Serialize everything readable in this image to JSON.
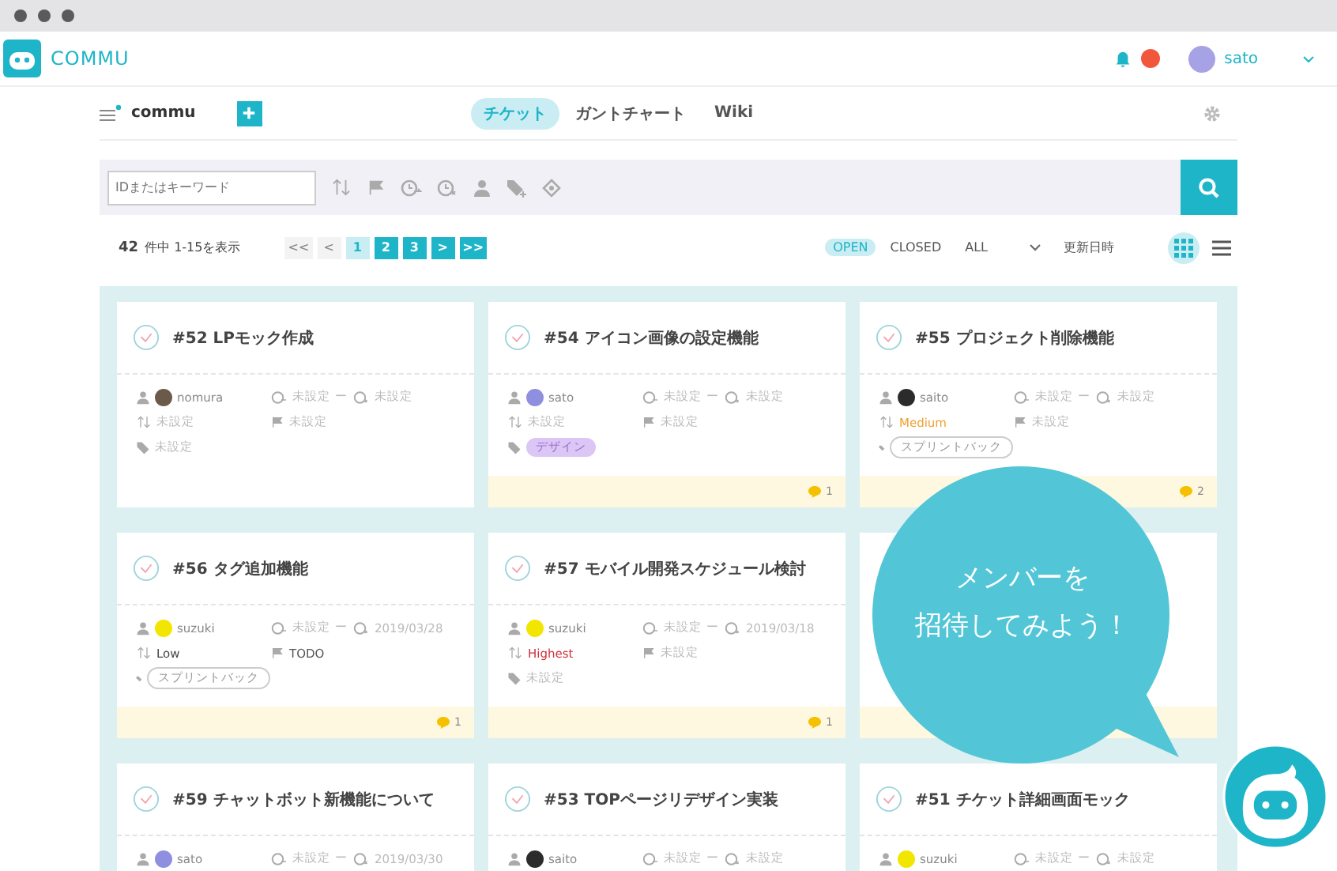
{
  "app": {
    "brand": "COMMU",
    "notification": true,
    "user": "sato"
  },
  "project": {
    "name": "commu"
  },
  "tabs": [
    {
      "label": "チケット",
      "selected": true
    },
    {
      "label": "ガントチャート",
      "selected": false
    },
    {
      "label": "Wiki",
      "selected": false
    }
  ],
  "search": {
    "placeholder": "IDまたはキーワード"
  },
  "summary": {
    "count": "42",
    "text": "件中 1-15を表示"
  },
  "pager": [
    {
      "label": "<<",
      "selected": false,
      "disabled": true
    },
    {
      "label": "<",
      "selected": false,
      "disabled": true
    },
    {
      "label": "1",
      "selected": true,
      "disabled": false
    },
    {
      "label": "2",
      "selected": false,
      "disabled": false
    },
    {
      "label": "3",
      "selected": false,
      "disabled": false
    },
    {
      "label": ">",
      "selected": false,
      "disabled": false
    },
    {
      "label": ">>",
      "selected": false,
      "disabled": false
    }
  ],
  "status_filter": [
    {
      "label": "OPEN",
      "selected": true
    },
    {
      "label": "CLOSED",
      "selected": false
    }
  ],
  "scope": {
    "value": "ALL"
  },
  "sort": {
    "value": "更新日時"
  },
  "views": [
    {
      "kind": "grid",
      "selected": true
    },
    {
      "kind": "list",
      "selected": false
    }
  ],
  "tickets": [
    {
      "kind": "card",
      "title": "#52 LPモック作成",
      "assignee": {
        "name": "nomura",
        "color": "#6b5a4a"
      },
      "start": "未設定",
      "sep": "ー",
      "end": "未設定",
      "priority": {
        "label": "未設定",
        "kind": "none"
      },
      "status": {
        "label": "未設定",
        "kind": "none"
      },
      "tag": {
        "label": "未設定",
        "kind": "none"
      }
    },
    {
      "kind": "card",
      "title": "#54 アイコン画像の設定機能",
      "assignee": {
        "name": "sato",
        "color": "#8f8fe0"
      },
      "start": "未設定",
      "sep": "ー",
      "end": "未設定",
      "priority": {
        "label": "未設定",
        "kind": "none"
      },
      "status": {
        "label": "未設定",
        "kind": "none"
      },
      "tag": {
        "label": "デザイン",
        "kind": "filled",
        "color": "#dcc6f5"
      },
      "comments": "1"
    },
    {
      "kind": "card",
      "title": "#55 プロジェクト削除機能",
      "assignee": {
        "name": "saito",
        "color": "#2b2b2b"
      },
      "start": "未設定",
      "sep": "ー",
      "end": "未設定",
      "priority": {
        "label": "Medium",
        "kind": "medium"
      },
      "status": {
        "label": "未設定",
        "kind": "none"
      },
      "tag": {
        "label": "スプリントバック",
        "kind": "outline"
      },
      "comments": "2"
    },
    {
      "kind": "card",
      "title": "#56 タグ追加機能",
      "assignee": {
        "name": "suzuki",
        "color": "#f2e600"
      },
      "start": "未設定",
      "sep": "ー",
      "end": "2019/03/28",
      "priority": {
        "label": "Low",
        "kind": "low"
      },
      "status": {
        "label": "TODO",
        "kind": "set"
      },
      "tag": {
        "label": "スプリントバック",
        "kind": "outline"
      },
      "comments": "1"
    },
    {
      "kind": "card",
      "title": "#57 モバイル開発スケジュール検討",
      "assignee": {
        "name": "suzuki",
        "color": "#f2e600"
      },
      "start": "未設定",
      "sep": "ー",
      "end": "2019/03/18",
      "priority": {
        "label": "Highest",
        "kind": "highest"
      },
      "status": {
        "label": "未設定",
        "kind": "none"
      },
      "tag": {
        "label": "未設定",
        "kind": "none"
      },
      "comments": "1"
    },
    {
      "kind": "covered"
    },
    {
      "kind": "card",
      "title": "#59 チャットボット新機能について",
      "assignee": {
        "name": "sato",
        "color": "#8f8fe0"
      },
      "start": "未設定",
      "sep": "ー",
      "end": "2019/03/30"
    },
    {
      "kind": "card",
      "title": "#53 TOPページリデザイン実装",
      "assignee": {
        "name": "saito",
        "color": "#2b2b2b"
      },
      "start": "未設定",
      "sep": "ー",
      "end": "未設定"
    },
    {
      "kind": "card",
      "title": "#51 チケット詳細画面モック",
      "assignee": {
        "name": "suzuki",
        "color": "#f2e600"
      },
      "start": "未設定",
      "sep": "ー",
      "end": "未設定"
    }
  ],
  "bubble": {
    "lines": [
      "メンバーを",
      "招待してみよう！"
    ]
  }
}
